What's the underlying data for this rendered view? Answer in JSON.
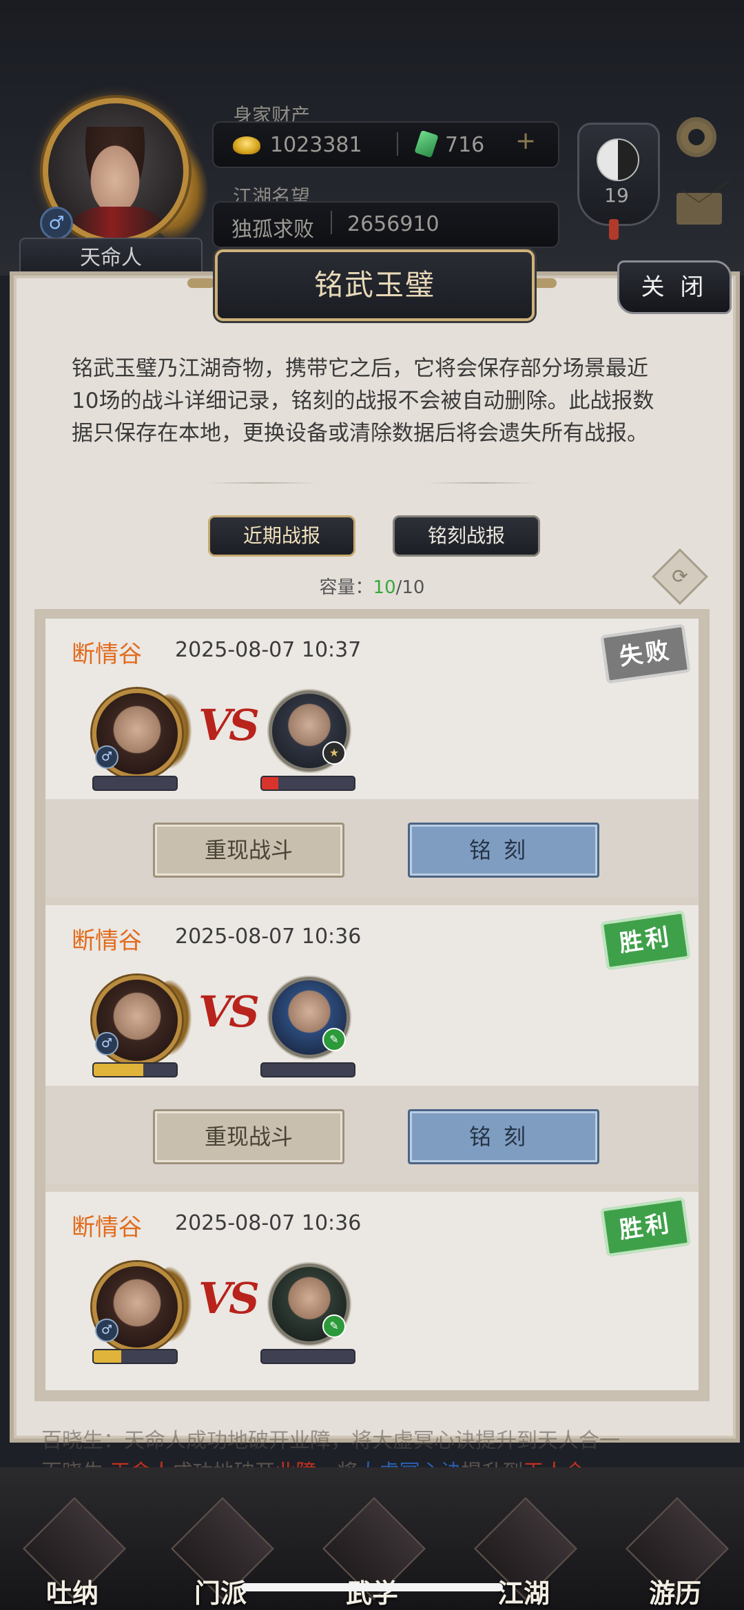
{
  "hud": {
    "title": "天命人",
    "gender_symbol": "♂",
    "wealth_label": "身家财产",
    "gold": "1023381",
    "jade": "716",
    "plus": "+",
    "fame_label": "江湖名望",
    "fame_title": "独孤求败",
    "fame_value": "2656910",
    "taiji_level": "19"
  },
  "modal": {
    "title": "铭武玉璧",
    "close": "关 闭",
    "description": "铭武玉璧乃江湖奇物，携带它之后，它将会保存部分场景最近10场的战斗详细记录，铭刻的战报不会被自动删除。此战报数据只保存在本地，更换设备或清除数据后将会遗失所有战报。",
    "tabs": [
      "近期战报",
      "铭刻战报"
    ],
    "capacity_label": "容量：",
    "capacity_current": "10",
    "capacity_max": "/10",
    "refresh_symbol": "⟳"
  },
  "battles": [
    {
      "scene": "断情谷",
      "time": "2025-08-07 10:37",
      "result": "失败",
      "vs": "VS",
      "player_hp": 0.0,
      "enemy_hp": 0.18,
      "replay": "重现战斗",
      "engrave": "铭刻",
      "enemy_badge": "★"
    },
    {
      "scene": "断情谷",
      "time": "2025-08-07 10:36",
      "result": "胜利",
      "vs": "VS",
      "player_hp": 0.6,
      "enemy_hp": 0.0,
      "replay": "重现战斗",
      "engrave": "铭刻",
      "enemy_badge": "✎"
    },
    {
      "scene": "断情谷",
      "time": "2025-08-07 10:36",
      "result": "胜利",
      "vs": "VS",
      "player_hp": 0.33,
      "enemy_hp": 0.0,
      "enemy_badge": "✎"
    }
  ],
  "feed": {
    "line1": "百晓生：天命人成功地破开业障，将大虚冥心诀提升到天人合一",
    "line2_prefix": "百晓生·",
    "line2_name": "天命人",
    "line2_mid1": "成功地破开",
    "line2_obstacle": "业障",
    "line2_mid2": "，将",
    "line2_skill": "大虚冥心诀",
    "line2_mid3": "提升到",
    "line2_level": "天人合一"
  },
  "nav": [
    "吐纳",
    "门派",
    "武学",
    "江湖",
    "游历"
  ],
  "colors": {
    "win": "#3fa04a",
    "lose": "#7a7a7a",
    "scene": "#e16b1c",
    "hp_player": "#e0b43a",
    "hp_enemy": "#d9342b"
  }
}
